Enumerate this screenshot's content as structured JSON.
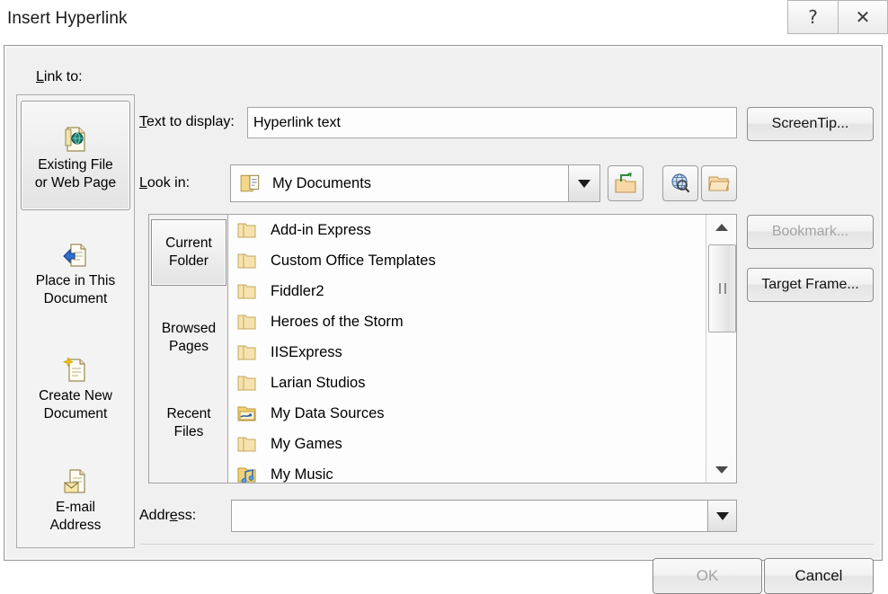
{
  "window": {
    "title": "Insert Hyperlink",
    "help_icon": "question-mark-icon",
    "close_icon": "close-x-icon",
    "help_glyph": "?",
    "close_glyph": "✕"
  },
  "link_to": {
    "label": "Link to:",
    "items": [
      {
        "label": "Existing File\nor Web Page",
        "icon": "document-with-globe-icon",
        "selected": true
      },
      {
        "label": "Place in This\nDocument",
        "icon": "document-with-arrow-icon",
        "selected": false
      },
      {
        "label": "Create New\nDocument",
        "icon": "new-document-icon",
        "selected": false
      },
      {
        "label": "E-mail\nAddress",
        "icon": "document-with-envelope-icon",
        "selected": false
      }
    ]
  },
  "text_to_display": {
    "label": "Text to display:",
    "value": "Hyperlink text",
    "placeholder": ""
  },
  "buttons": {
    "screentip": "ScreenTip...",
    "bookmark": "Bookmark...",
    "bookmark_disabled": true,
    "target_frame": "Target Frame...",
    "ok": "OK",
    "ok_disabled": true,
    "cancel": "Cancel"
  },
  "look_in": {
    "label": "Look in:",
    "value": "My Documents",
    "folder_icon": "my-documents-folder-icon",
    "dropdown_icon": "chevron-down-icon"
  },
  "toolbar": [
    {
      "name": "up-one-folder-button",
      "icon": "folder-up-arrow-icon"
    },
    {
      "name": "browse-the-web-button",
      "icon": "globe-magnifier-icon"
    },
    {
      "name": "browse-for-file-button",
      "icon": "open-folder-icon"
    }
  ],
  "browse_tabs": [
    {
      "label": "Current\nFolder",
      "selected": true
    },
    {
      "label": "Browsed\nPages",
      "selected": false
    },
    {
      "label": "Recent\nFiles",
      "selected": false
    }
  ],
  "file_list": [
    {
      "name": "Add-in Express",
      "icon": "folder-icon"
    },
    {
      "name": "Custom Office Templates",
      "icon": "folder-icon"
    },
    {
      "name": "Fiddler2",
      "icon": "folder-icon"
    },
    {
      "name": "Heroes of the Storm",
      "icon": "folder-icon"
    },
    {
      "name": "IISExpress",
      "icon": "folder-icon"
    },
    {
      "name": "Larian Studios",
      "icon": "folder-icon"
    },
    {
      "name": "My Data Sources",
      "icon": "data-sources-folder-icon"
    },
    {
      "name": "My Games",
      "icon": "folder-icon"
    },
    {
      "name": "My Music",
      "icon": "my-music-folder-icon"
    }
  ],
  "scrollbar": {
    "up_icon": "scroll-up-arrow-icon",
    "down_icon": "scroll-down-arrow-icon"
  },
  "address": {
    "label": "Address:",
    "value": "",
    "placeholder": "",
    "dropdown_icon": "chevron-down-icon"
  },
  "colors": {
    "dialog_bg": "#f0f0f0",
    "field_bg": "#fdfdfd",
    "border": "#9a9a9a",
    "disabled_text": "#a4a4a4",
    "folder_yellow": "#f5d98a"
  }
}
